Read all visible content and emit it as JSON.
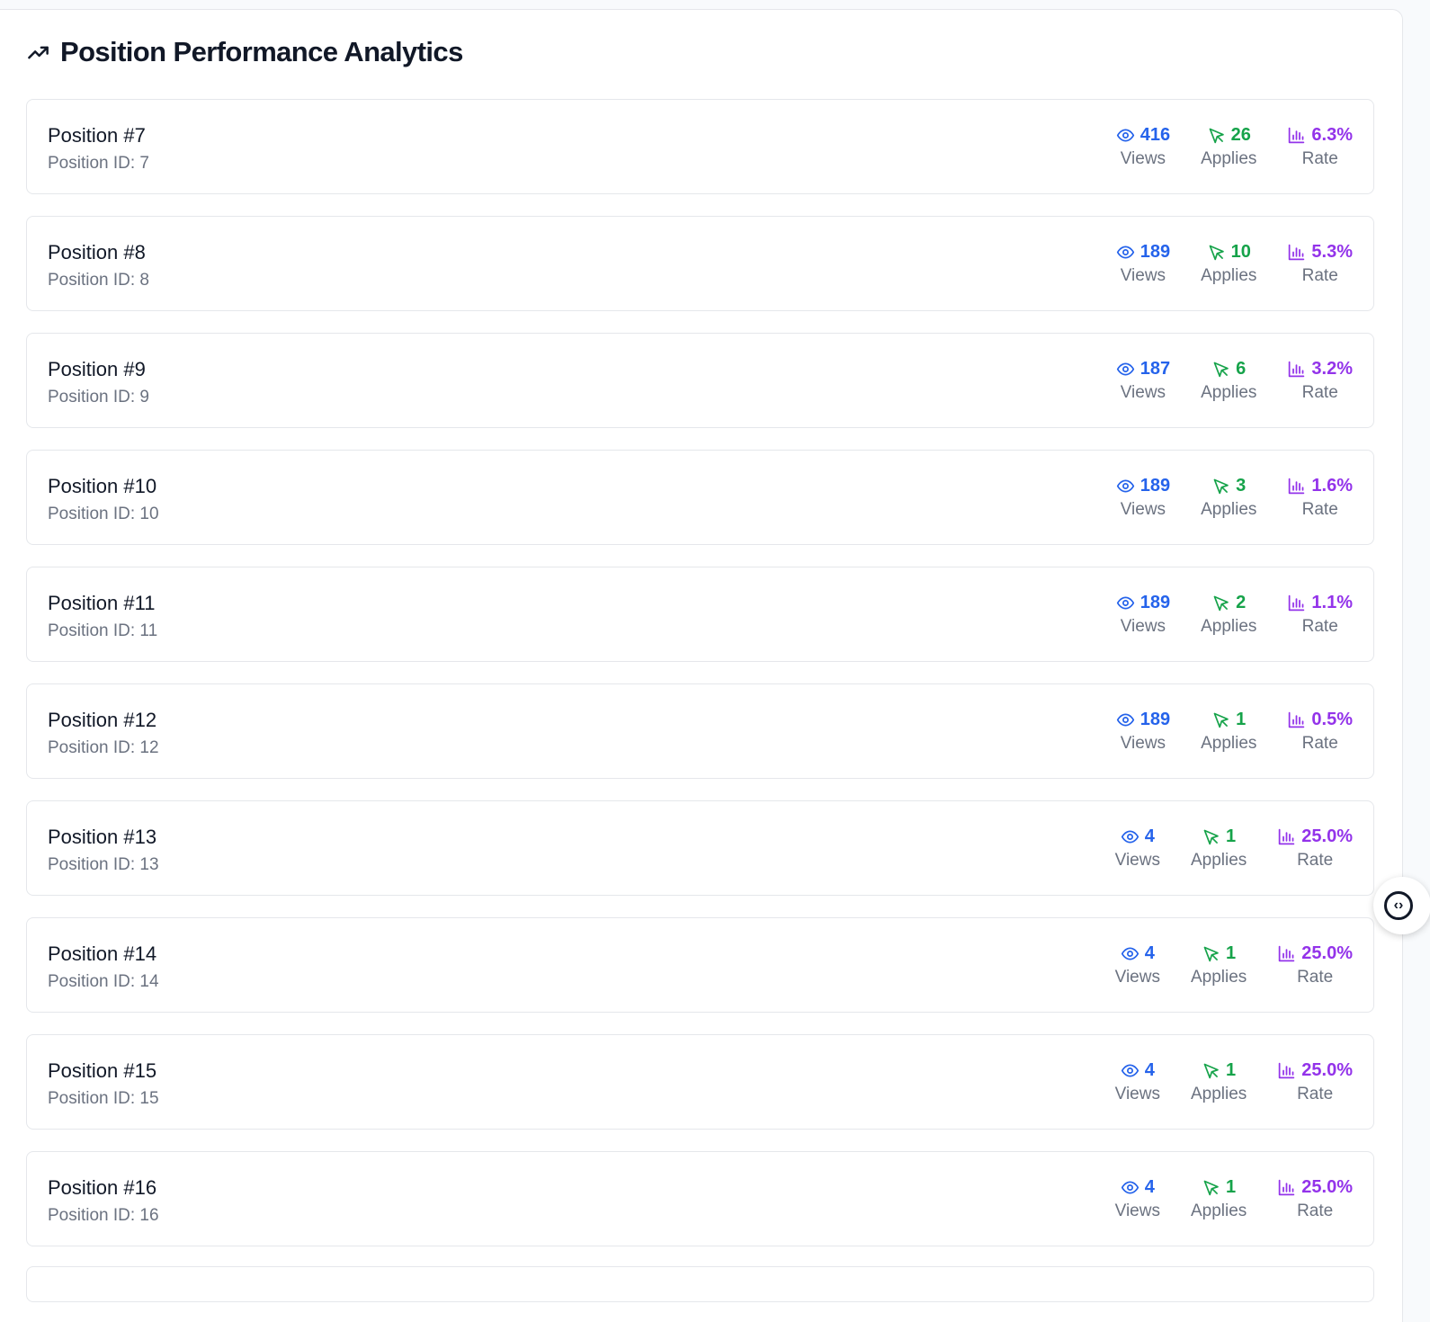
{
  "header": {
    "title": "Position Performance Analytics",
    "icon": "trending-up-icon"
  },
  "labels": {
    "views": "Views",
    "applies": "Applies",
    "rate": "Rate"
  },
  "colors": {
    "views": "#2563eb",
    "applies": "#16a34a",
    "rate": "#9333ea"
  },
  "positions": [
    {
      "name": "Position #7",
      "pid": "Position ID: 7",
      "views": "416",
      "applies": "26",
      "rate": "6.3%"
    },
    {
      "name": "Position #8",
      "pid": "Position ID: 8",
      "views": "189",
      "applies": "10",
      "rate": "5.3%"
    },
    {
      "name": "Position #9",
      "pid": "Position ID: 9",
      "views": "187",
      "applies": "6",
      "rate": "3.2%"
    },
    {
      "name": "Position #10",
      "pid": "Position ID: 10",
      "views": "189",
      "applies": "3",
      "rate": "1.6%"
    },
    {
      "name": "Position #11",
      "pid": "Position ID: 11",
      "views": "189",
      "applies": "2",
      "rate": "1.1%"
    },
    {
      "name": "Position #12",
      "pid": "Position ID: 12",
      "views": "189",
      "applies": "1",
      "rate": "0.5%"
    },
    {
      "name": "Position #13",
      "pid": "Position ID: 13",
      "views": "4",
      "applies": "1",
      "rate": "25.0%"
    },
    {
      "name": "Position #14",
      "pid": "Position ID: 14",
      "views": "4",
      "applies": "1",
      "rate": "25.0%"
    },
    {
      "name": "Position #15",
      "pid": "Position ID: 15",
      "views": "4",
      "applies": "1",
      "rate": "25.0%"
    },
    {
      "name": "Position #16",
      "pid": "Position ID: 16",
      "views": "4",
      "applies": "1",
      "rate": "25.0%"
    }
  ],
  "floating_button": {
    "icon": "code-brackets-icon",
    "glyph": "‹›"
  }
}
